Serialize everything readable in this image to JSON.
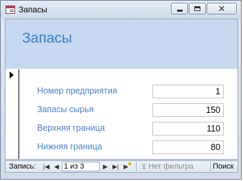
{
  "window": {
    "title": "Запасы"
  },
  "form": {
    "title": "Запасы",
    "fields": [
      {
        "label": "Номер предприятия",
        "value": "1"
      },
      {
        "label": "Запасы сырья",
        "value": "150"
      },
      {
        "label": "Верхняя граница",
        "value": "110"
      },
      {
        "label": "Нижняя граница",
        "value": "80"
      }
    ]
  },
  "statusbar": {
    "record_label": "Запись:",
    "record_position": "1 из 3",
    "filter_label": "Нет фильтра",
    "search_label": "Поиск",
    "icons": {
      "first": "first-record-icon",
      "prev": "previous-record-icon",
      "next": "next-record-icon",
      "last": "last-record-icon",
      "new": "new-record-icon",
      "filter": "filter-icon"
    }
  },
  "colors": {
    "header_bg": "#c6d9f0",
    "title_text": "#3d7cc9",
    "label_text": "#4a7fc5"
  }
}
